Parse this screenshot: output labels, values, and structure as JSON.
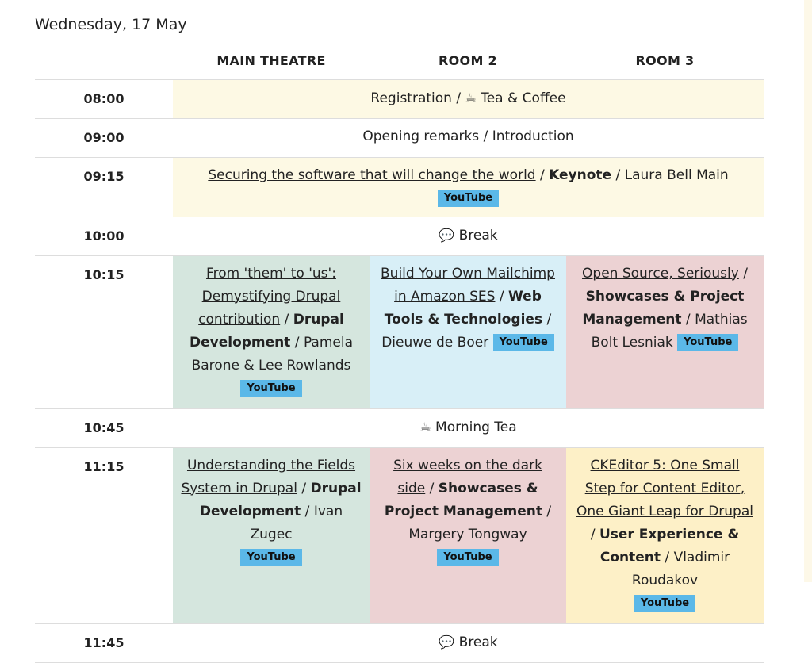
{
  "day": "Wednesday, 17 May",
  "columns": [
    "MAIN THEATRE",
    "ROOM 2",
    "ROOM 3"
  ],
  "rows": [
    {
      "time": "08:00",
      "text": "Registration / ",
      "icon": "☕",
      "text2": " Tea & Coffee"
    },
    {
      "time": "09:00",
      "text": "Opening remarks / Introduction"
    },
    {
      "time": "09:15",
      "title": "Securing the software that will change the world",
      "track": "Keynote",
      "speaker": "Laura Bell Main",
      "video": "YouTube"
    },
    {
      "time": "10:00",
      "icon": "💬",
      "text": " Break"
    },
    {
      "time": "10:15",
      "sessions": [
        {
          "title": "From 'them' to 'us': Demystifying Drupal contribution",
          "track": "Drupal Development",
          "speaker": "Pamela Barone & Lee Rowlands",
          "video": "YouTube"
        },
        {
          "title": "Build Your Own Mailchimp in Amazon SES",
          "track": "Web Tools & Technologies",
          "speaker": "Dieuwe de Boer",
          "video": "YouTube"
        },
        {
          "title": "Open Source, Seriously",
          "track": "Showcases & Project Management",
          "speaker": "Mathias Bolt Lesniak",
          "video": "YouTube"
        }
      ]
    },
    {
      "time": "10:45",
      "icon": "☕",
      "text": " Morning Tea"
    },
    {
      "time": "11:15",
      "sessions": [
        {
          "title": "Understanding the Fields System in Drupal",
          "track": "Drupal Development",
          "speaker": "Ivan Zugec",
          "video": "YouTube"
        },
        {
          "title": "Six weeks on the dark side",
          "track": "Showcases & Project Management",
          "speaker": "Margery Tongway",
          "video": "YouTube"
        },
        {
          "title": "CKEditor 5: One Small Step for Content Editor, One Giant Leap for Drupal",
          "track": "User Experience & Content",
          "speaker": "Vladimir Roudakov",
          "video": "YouTube"
        }
      ]
    },
    {
      "time": "11:45",
      "icon": "💬",
      "text": " Break"
    }
  ],
  "separator": " / ",
  "colors": {
    "yellow": "#fdf9e4",
    "green": "#d5e6de",
    "blue": "#d8eff7",
    "pink": "#ecd2d3",
    "beige": "#fdf0c7",
    "youtube": "#5bb8e8"
  }
}
